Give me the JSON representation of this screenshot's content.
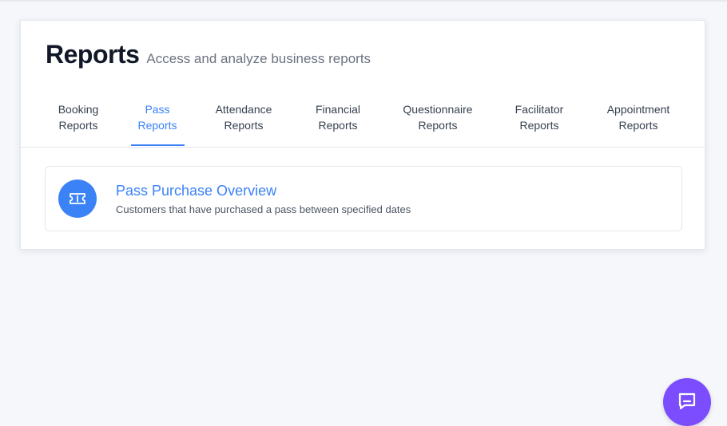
{
  "header": {
    "title": "Reports",
    "subtitle": "Access and analyze business reports"
  },
  "tabs": [
    {
      "line1": "Booking",
      "line2": "Reports",
      "active": false
    },
    {
      "line1": "Pass",
      "line2": "Reports",
      "active": true
    },
    {
      "line1": "Attendance",
      "line2": "Reports",
      "active": false
    },
    {
      "line1": "Financial",
      "line2": "Reports",
      "active": false
    },
    {
      "line1": "Questionnaire",
      "line2": "Reports",
      "active": false
    },
    {
      "line1": "Facilitator",
      "line2": "Reports",
      "active": false
    },
    {
      "line1": "Appointment",
      "line2": "Reports",
      "active": false
    }
  ],
  "reports": [
    {
      "title": "Pass Purchase Overview",
      "description": "Customers that have purchased a pass between specified dates",
      "icon": "ticket-icon"
    }
  ],
  "chat": {
    "icon": "chat-icon"
  },
  "colors": {
    "accent": "#3b82f6",
    "chat": "#7c4dff",
    "background": "#f5f7fb"
  }
}
